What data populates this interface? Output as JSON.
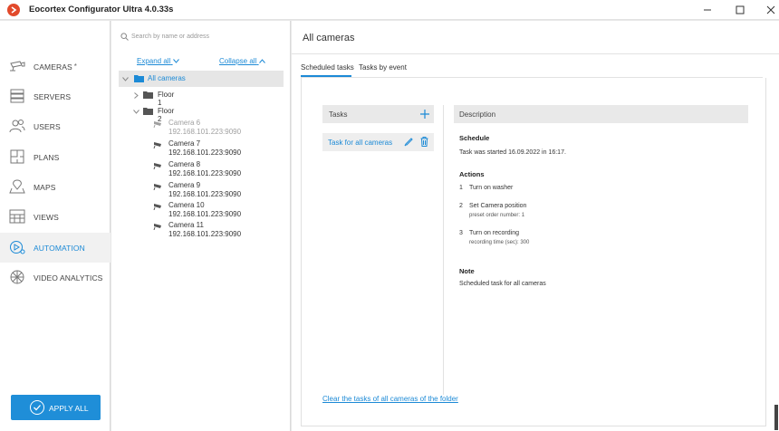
{
  "window": {
    "title": "Eocortex Configurator Ultra 4.0.33s",
    "minimize_glyph": "—",
    "maximize_glyph": "☐",
    "close_glyph": "✕"
  },
  "sidebar": {
    "items": [
      {
        "label": "CAMERAS",
        "icon": "camera-icon",
        "badge": "*"
      },
      {
        "label": "SERVERS",
        "icon": "servers-icon"
      },
      {
        "label": "USERS",
        "icon": "users-icon"
      },
      {
        "label": "PLANS",
        "icon": "plans-icon"
      },
      {
        "label": "MAPS",
        "icon": "maps-icon"
      },
      {
        "label": "VIEWS",
        "icon": "views-icon"
      },
      {
        "label": "AUTOMATION",
        "icon": "automation-icon",
        "active": true
      },
      {
        "label": "VIDEO ANALYTICS",
        "icon": "video-analytics-icon"
      }
    ],
    "apply_label": "APPLY ALL"
  },
  "tree": {
    "search_placeholder": "Search by name or address",
    "expand_all": "Expand all",
    "collapse_all": "Collapse all",
    "root": "All cameras",
    "folders": [
      "Floor 1",
      "Floor 2"
    ],
    "cameras": [
      {
        "name": "Camera 6",
        "ip": "192.168.101.223:9090",
        "disabled": true
      },
      {
        "name": "Camera 7",
        "ip": "192.168.101.223:9090"
      },
      {
        "name": "Camera 8",
        "ip": "192.168.101.223:9090"
      },
      {
        "name": "Camera 9",
        "ip": "192.168.101.223:9090"
      },
      {
        "name": "Camera 10",
        "ip": "192.168.101.223:9090"
      },
      {
        "name": "Camera 11",
        "ip": "192.168.101.223:9090"
      }
    ]
  },
  "main": {
    "title": "All cameras",
    "tabs": [
      "Scheduled tasks",
      "Tasks by event"
    ],
    "tasks_header": "Tasks",
    "task_item": "Task for all cameras",
    "description_header": "Description",
    "schedule_heading": "Schedule",
    "schedule_text": "Task was started 16.09.2022 in 16:17.",
    "actions_heading": "Actions",
    "actions": [
      {
        "num": "1",
        "text": "Turn on washer",
        "sub": ""
      },
      {
        "num": "2",
        "text": "Set Camera position",
        "sub": "preset order number: 1"
      },
      {
        "num": "3",
        "text": "Turn on recording",
        "sub": "recording time (sec): 300"
      }
    ],
    "note_heading": "Note",
    "note_text": "Scheduled task for all cameras",
    "clear_link": "Clear the tasks of all cameras of the folder"
  },
  "colors": {
    "accent": "#1c8ad6",
    "apply_button": "#1f8ed8",
    "logo": "#e24a2b"
  }
}
